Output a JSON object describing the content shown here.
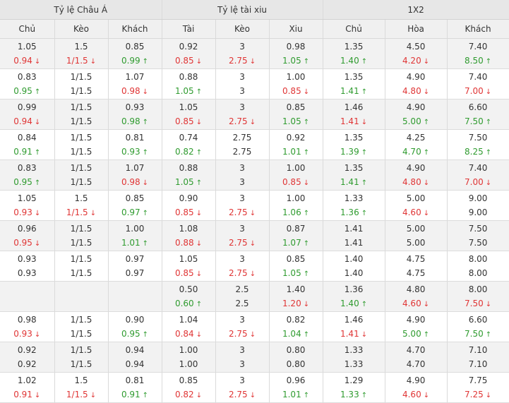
{
  "headers": {
    "groups": [
      "Tỷ lệ Châu Á",
      "Tỷ lệ tài xiu",
      "1X2"
    ],
    "columns": [
      "Chủ",
      "Kèo",
      "Khách",
      "Tài",
      "Kèo",
      "Xiu",
      "Chủ",
      "Hòa",
      "Khách"
    ]
  },
  "icons": {
    "up": "arrow-up-icon",
    "down": "arrow-down-icon"
  },
  "colors": {
    "up": "#2f9b2f",
    "down": "#e03535"
  },
  "rows": [
    {
      "top": [
        "1.05",
        "1.5",
        "0.85",
        "0.92",
        "3",
        "0.98",
        "1.35",
        "4.50",
        "7.40"
      ],
      "bottom": [
        "0.94",
        "1/1.5",
        "0.99",
        "0.85",
        "2.75",
        "1.05",
        "1.40",
        "4.20",
        "8.50"
      ],
      "trend": [
        "down",
        "down",
        "up",
        "down",
        "down",
        "up",
        "up",
        "down",
        "up"
      ]
    },
    {
      "top": [
        "0.83",
        "1/1.5",
        "1.07",
        "0.88",
        "3",
        "1.00",
        "1.35",
        "4.90",
        "7.40"
      ],
      "bottom": [
        "0.95",
        "1/1.5",
        "0.98",
        "1.05",
        "3",
        "0.85",
        "1.41",
        "4.80",
        "7.00"
      ],
      "trend": [
        "up",
        "",
        "down",
        "up",
        "",
        "down",
        "up",
        "down",
        "down"
      ]
    },
    {
      "top": [
        "0.99",
        "1/1.5",
        "0.93",
        "1.05",
        "3",
        "0.85",
        "1.46",
        "4.90",
        "6.60"
      ],
      "bottom": [
        "0.94",
        "1/1.5",
        "0.98",
        "0.85",
        "2.75",
        "1.05",
        "1.41",
        "5.00",
        "7.50"
      ],
      "trend": [
        "down",
        "",
        "up",
        "down",
        "down",
        "up",
        "down",
        "up",
        "up"
      ]
    },
    {
      "top": [
        "0.84",
        "1/1.5",
        "0.81",
        "0.74",
        "2.75",
        "0.92",
        "1.35",
        "4.25",
        "7.50"
      ],
      "bottom": [
        "0.91",
        "1/1.5",
        "0.93",
        "0.82",
        "2.75",
        "1.01",
        "1.39",
        "4.70",
        "8.25"
      ],
      "trend": [
        "up",
        "",
        "up",
        "up",
        "",
        "up",
        "up",
        "up",
        "up"
      ]
    },
    {
      "top": [
        "0.83",
        "1/1.5",
        "1.07",
        "0.88",
        "3",
        "1.00",
        "1.35",
        "4.90",
        "7.40"
      ],
      "bottom": [
        "0.95",
        "1/1.5",
        "0.98",
        "1.05",
        "3",
        "0.85",
        "1.41",
        "4.80",
        "7.00"
      ],
      "trend": [
        "up",
        "",
        "down",
        "up",
        "",
        "down",
        "up",
        "down",
        "down"
      ]
    },
    {
      "top": [
        "1.05",
        "1.5",
        "0.85",
        "0.90",
        "3",
        "1.00",
        "1.33",
        "5.00",
        "9.00"
      ],
      "bottom": [
        "0.93",
        "1/1.5",
        "0.97",
        "0.85",
        "2.75",
        "1.06",
        "1.36",
        "4.60",
        "9.00"
      ],
      "trend": [
        "down",
        "down",
        "up",
        "down",
        "down",
        "up",
        "up",
        "down",
        ""
      ]
    },
    {
      "top": [
        "0.96",
        "1/1.5",
        "1.00",
        "1.08",
        "3",
        "0.87",
        "1.41",
        "5.00",
        "7.50"
      ],
      "bottom": [
        "0.95",
        "1/1.5",
        "1.01",
        "0.88",
        "2.75",
        "1.07",
        "1.41",
        "5.00",
        "7.50"
      ],
      "trend": [
        "down",
        "",
        "up",
        "down",
        "down",
        "up",
        "",
        "",
        ""
      ]
    },
    {
      "top": [
        "0.93",
        "1/1.5",
        "0.97",
        "1.05",
        "3",
        "0.85",
        "1.40",
        "4.75",
        "8.00"
      ],
      "bottom": [
        "0.93",
        "1/1.5",
        "0.97",
        "0.85",
        "2.75",
        "1.05",
        "1.40",
        "4.75",
        "8.00"
      ],
      "trend": [
        "",
        "",
        "",
        "down",
        "down",
        "up",
        "",
        "",
        ""
      ]
    },
    {
      "top": [
        "",
        "",
        "",
        "0.50",
        "2.5",
        "1.40",
        "1.36",
        "4.80",
        "8.00"
      ],
      "bottom": [
        "",
        "",
        "",
        "0.60",
        "2.5",
        "1.20",
        "1.40",
        "4.60",
        "7.50"
      ],
      "trend": [
        "",
        "",
        "",
        "up",
        "",
        "down",
        "up",
        "down",
        "down"
      ]
    },
    {
      "top": [
        "0.98",
        "1/1.5",
        "0.90",
        "1.04",
        "3",
        "0.82",
        "1.46",
        "4.90",
        "6.60"
      ],
      "bottom": [
        "0.93",
        "1/1.5",
        "0.95",
        "0.84",
        "2.75",
        "1.04",
        "1.41",
        "5.00",
        "7.50"
      ],
      "trend": [
        "down",
        "",
        "up",
        "down",
        "down",
        "up",
        "down",
        "up",
        "up"
      ]
    },
    {
      "top": [
        "0.92",
        "1/1.5",
        "0.94",
        "1.00",
        "3",
        "0.80",
        "1.33",
        "4.70",
        "7.10"
      ],
      "bottom": [
        "0.92",
        "1/1.5",
        "0.94",
        "1.00",
        "3",
        "0.80",
        "1.33",
        "4.70",
        "7.10"
      ],
      "trend": [
        "",
        "",
        "",
        "",
        "",
        "",
        "",
        "",
        ""
      ]
    },
    {
      "top": [
        "1.02",
        "1.5",
        "0.81",
        "0.85",
        "3",
        "0.96",
        "1.29",
        "4.90",
        "7.75"
      ],
      "bottom": [
        "0.91",
        "1/1.5",
        "0.91",
        "0.82",
        "2.75",
        "1.01",
        "1.33",
        "4.60",
        "7.25"
      ],
      "trend": [
        "down",
        "down",
        "up",
        "down",
        "down",
        "up",
        "up",
        "down",
        "down"
      ]
    }
  ]
}
